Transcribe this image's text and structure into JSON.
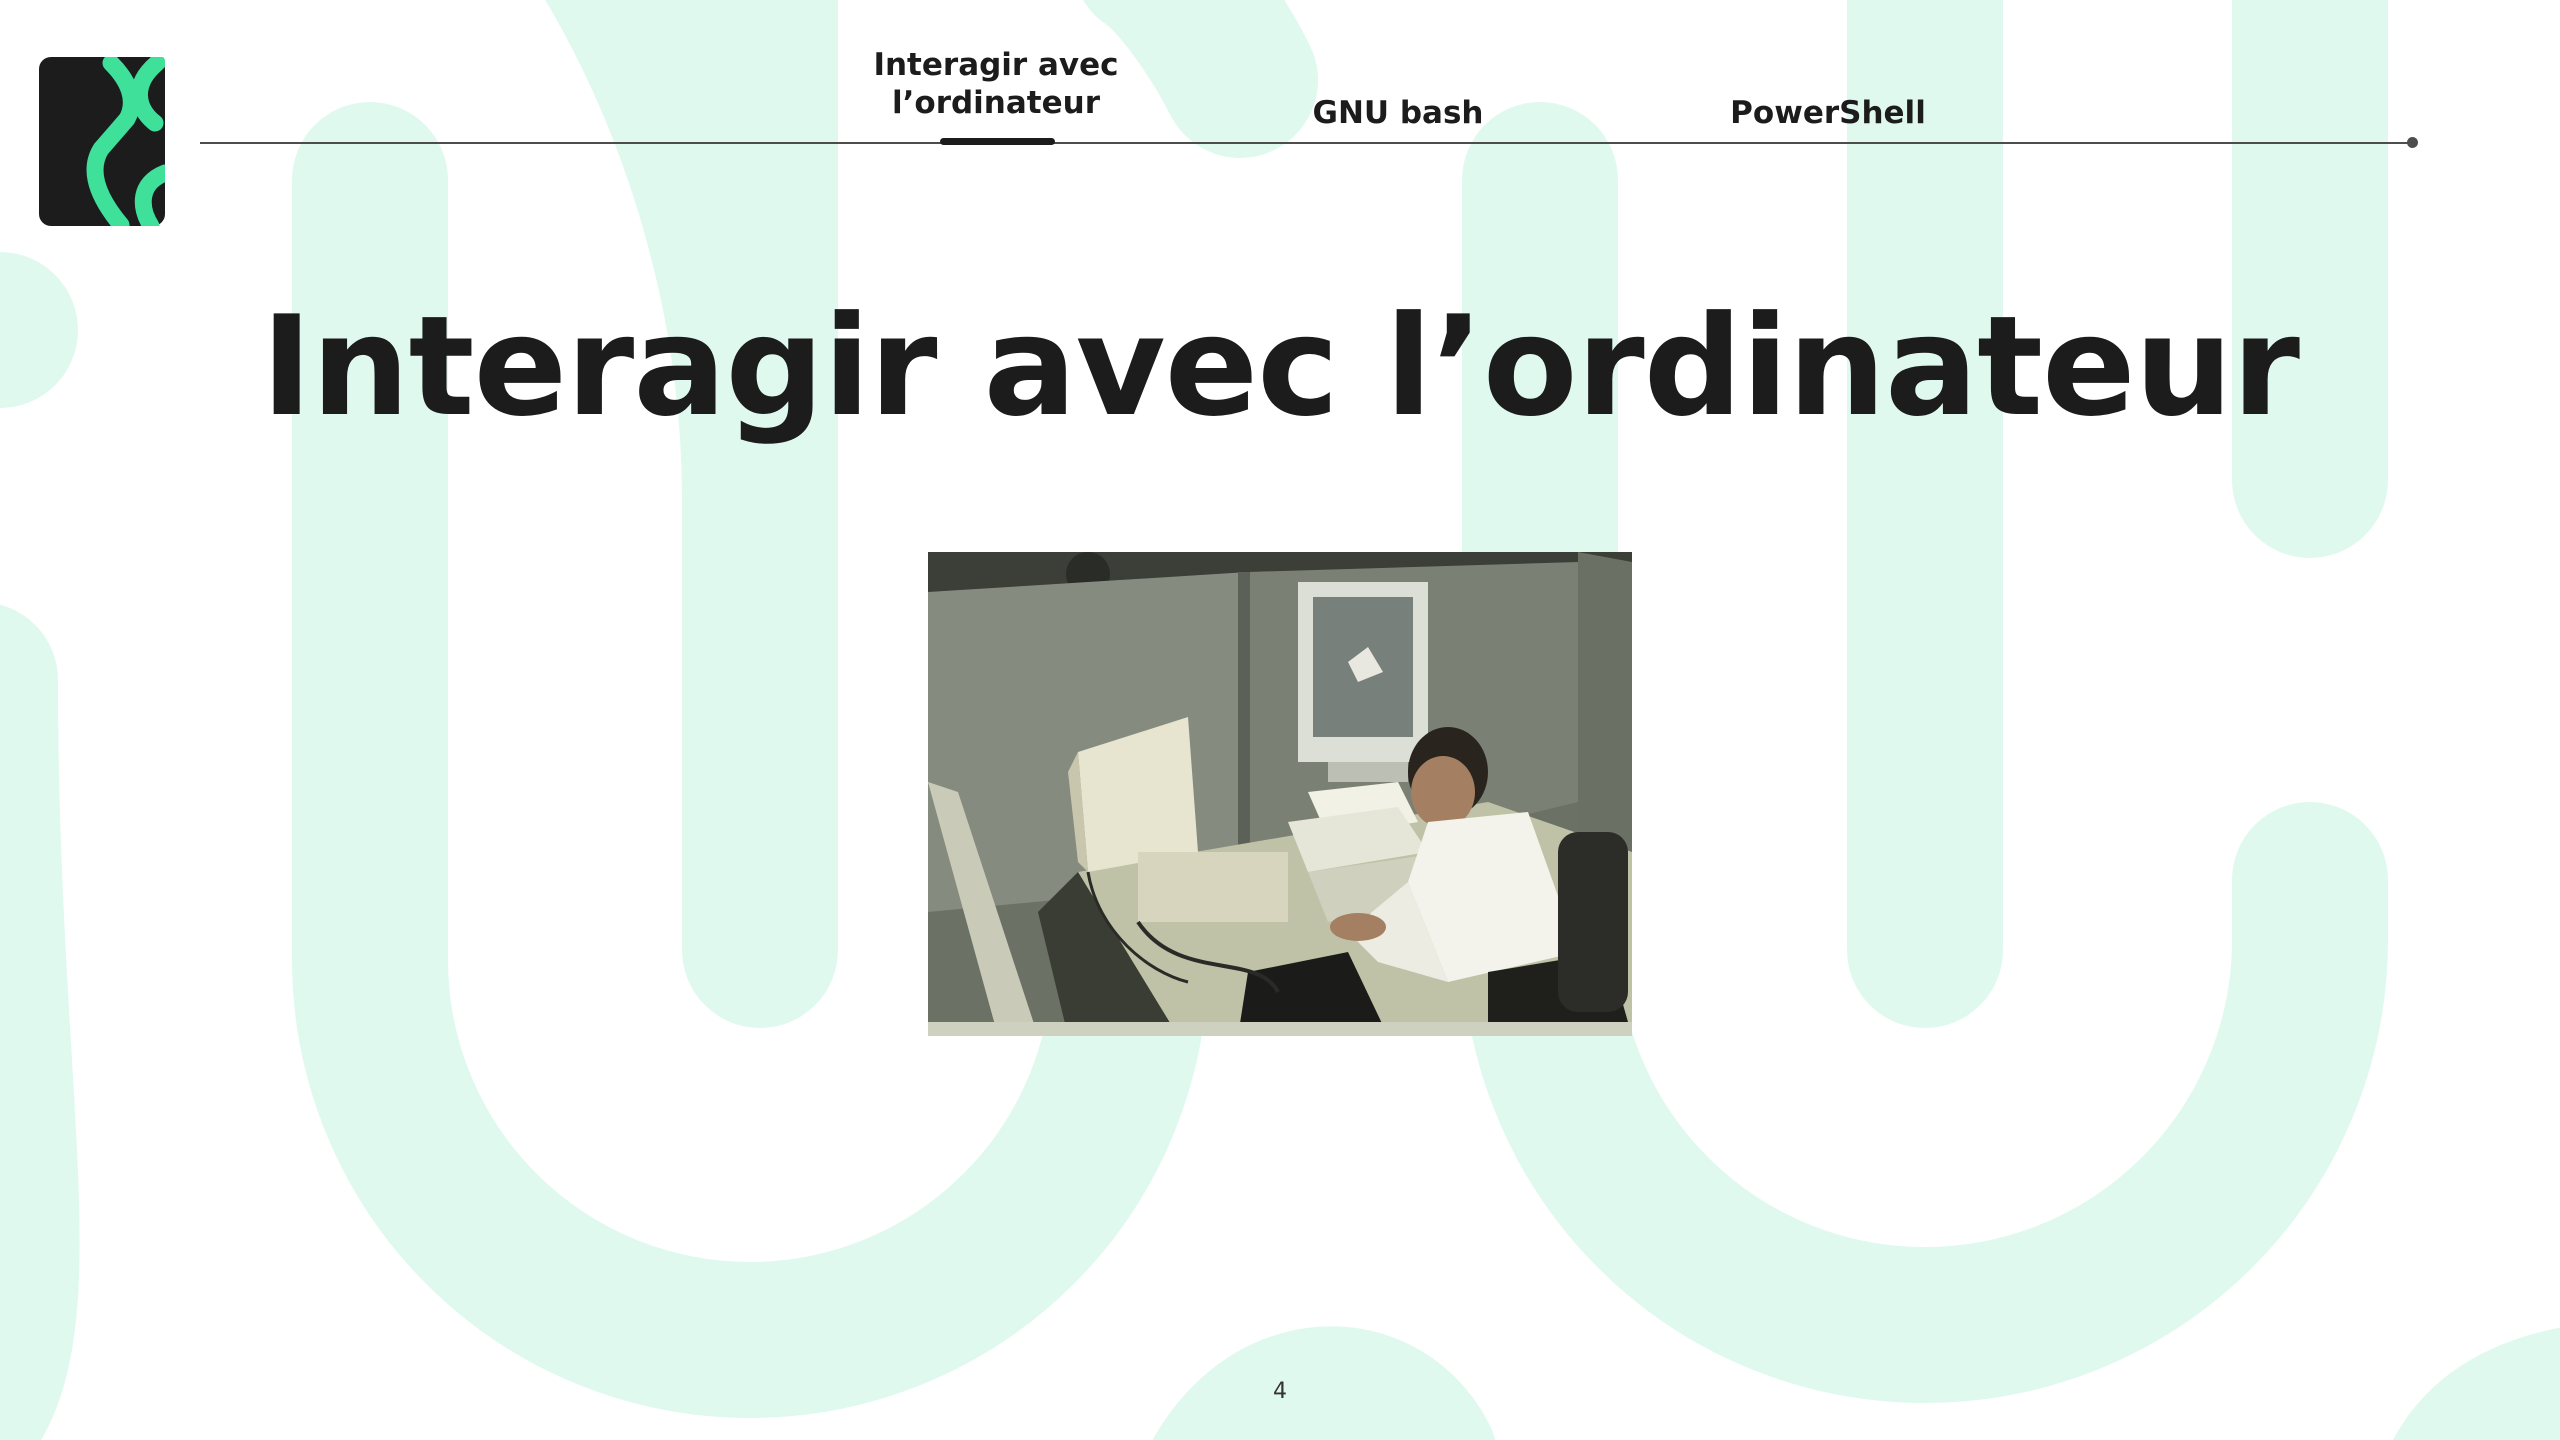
{
  "nav": {
    "items": [
      {
        "label_lines": [
          "Interagir avec",
          "l’ordinateur"
        ],
        "active": true
      },
      {
        "label_lines": [
          "GNU bash"
        ],
        "active": false
      },
      {
        "label_lines": [
          "PowerShell"
        ],
        "active": false
      }
    ]
  },
  "slide": {
    "title": "Interagir avec l’ordinateur",
    "page_number": "4"
  },
  "colors": {
    "background": "#ffffff",
    "decor_shapes": "#e0f9ef",
    "accent_green": "#3ee09a",
    "logo_dark": "#1c1c1c",
    "text": "#1c1c1c",
    "nav_line": "#4d4d4d"
  },
  "icons": {
    "logo": "chevron-logo-icon",
    "nav_end": "dot-icon"
  }
}
